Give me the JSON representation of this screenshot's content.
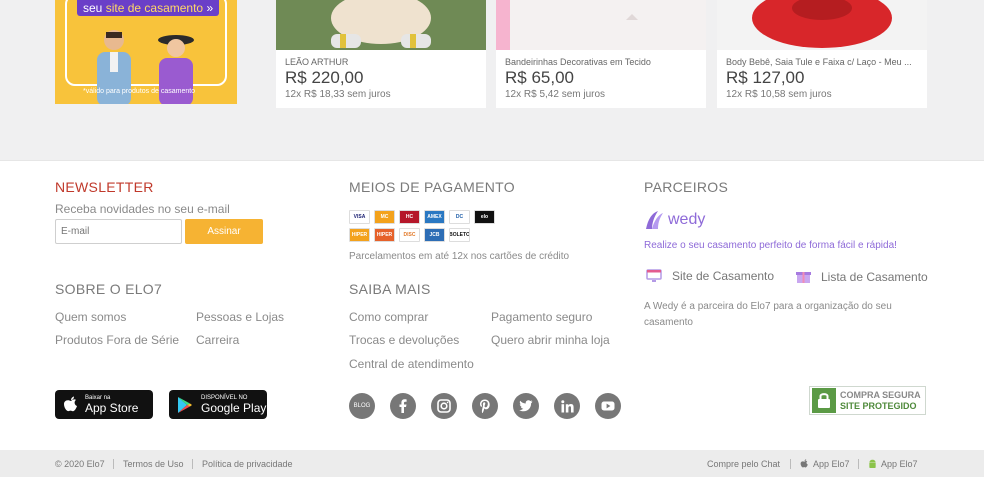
{
  "promo": {
    "chip_prefix": "seu",
    "chip_highlight": "site de casamento",
    "chip_suffix": "»",
    "note": "*válido para produtos de casamento"
  },
  "products": [
    {
      "title": "LEÃO ARTHUR",
      "price": "R$ 220,00",
      "installments": "12x R$ 18,33 sem juros"
    },
    {
      "title": "Bandeirinhas Decorativas em Tecido",
      "price": "R$ 65,00",
      "installments": "12x R$ 5,42 sem juros"
    },
    {
      "title": "Body Bebê, Saia Tule e Faixa c/ Laço - Meu ...",
      "price": "R$ 127,00",
      "installments": "12x R$ 10,58 sem juros"
    }
  ],
  "newsletter": {
    "heading": "NEWSLETTER",
    "subtitle": "Receba novidades no seu e-mail",
    "placeholder": "E-mail",
    "button": "Assinar"
  },
  "payment": {
    "heading": "MEIOS DE PAGAMENTO",
    "row1": [
      "VISA",
      "MC",
      "HC",
      "AMEX",
      "DC",
      "elo"
    ],
    "row2": [
      "HIPER",
      "HIPER",
      "DISC",
      "JCB",
      "BOLETO"
    ],
    "note": "Parcelamentos em até 12x nos cartões de crédito"
  },
  "partners": {
    "heading": "PARCEIROS",
    "brand": "wedy",
    "tagline": "Realize o seu casamento perfeito de forma fácil e rápida!",
    "site_link": "Site de Casamento",
    "list_link": "Lista de Casamento",
    "about_line1": "A Wedy é a parceira do Elo7 para a organização do seu",
    "about_line2": "casamento"
  },
  "about": {
    "heading": "SOBRE O ELO7",
    "links": [
      "Quem somos",
      "Pessoas e Lojas",
      "Produtos Fora de Série",
      "Carreira"
    ]
  },
  "know_more": {
    "heading": "SAIBA MAIS",
    "links": [
      "Como comprar",
      "Pagamento seguro",
      "Trocas e devoluções",
      "Quero abrir minha loja",
      "Central de atendimento"
    ]
  },
  "apps": {
    "appstore_small": "Baixar na",
    "appstore_big": "App Store",
    "play_small": "DISPONÍVEL NO",
    "play_big": "Google Play"
  },
  "social": {
    "blog": "BLOG",
    "icons": [
      "facebook-icon",
      "instagram-icon",
      "pinterest-icon",
      "twitter-icon",
      "linkedin-icon",
      "youtube-icon"
    ]
  },
  "secure_badge": {
    "line1": "COMPRA SEGURA",
    "line2": "SITE PROTEGIDO"
  },
  "bottom": {
    "copyright": "© 2020 Elo7",
    "terms": "Termos de Uso",
    "privacy": "Política de privacidade",
    "chat": "Compre pelo Chat",
    "app_ios": "App Elo7",
    "app_android": "App Elo7"
  },
  "colors": {
    "accent_red": "#c0392b",
    "subscribe": "#f6b333",
    "wedy_purple": "#8e6ad8",
    "promo_yellow": "#f8c33b"
  }
}
